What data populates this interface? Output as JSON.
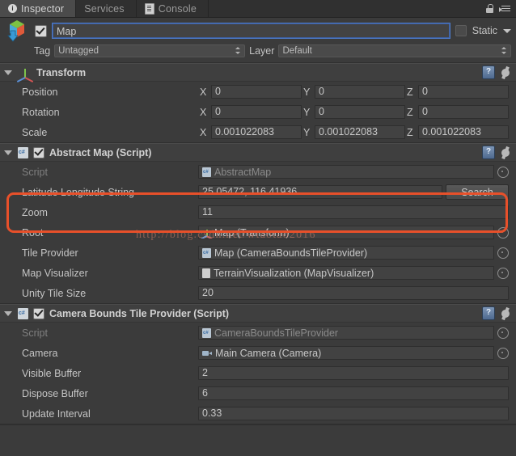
{
  "window": {
    "tabs": [
      {
        "label": "Inspector",
        "icon": "inspector-icon",
        "active": true
      },
      {
        "label": "Services",
        "icon": "",
        "active": false
      },
      {
        "label": "Console",
        "icon": "console-icon",
        "active": false
      }
    ],
    "lock_icon": "lock-icon",
    "menu_icon": "hamburger-menu-icon"
  },
  "gameobject": {
    "icon": "prefab-cube-icon",
    "enabled": true,
    "name": "Map",
    "name_placeholder": "Name",
    "static_label": "Static",
    "static_checked": false,
    "tag_label": "Tag",
    "tag_value": "Untagged",
    "layer_label": "Layer",
    "layer_value": "Default"
  },
  "components": [
    {
      "id": "transform",
      "title": "Transform",
      "icon": "transform-axis-icon",
      "has_checkbox": false,
      "expanded": true,
      "rows": [
        {
          "type": "vector3",
          "label": "Position",
          "axes": [
            "X",
            "Y",
            "Z"
          ],
          "values": [
            "0",
            "0",
            "0"
          ]
        },
        {
          "type": "vector3",
          "label": "Rotation",
          "axes": [
            "X",
            "Y",
            "Z"
          ],
          "values": [
            "0",
            "0",
            "0"
          ]
        },
        {
          "type": "vector3",
          "label": "Scale",
          "axes": [
            "X",
            "Y",
            "Z"
          ],
          "values": [
            "0.001022083",
            "0.001022083",
            "0.001022083"
          ]
        }
      ]
    },
    {
      "id": "abstract-map",
      "title": "Abstract Map (Script)",
      "icon": "csharp-script-icon",
      "has_checkbox": true,
      "checked": true,
      "expanded": true,
      "rows": [
        {
          "type": "object",
          "label": "Script",
          "value": "AbstractMap",
          "dim": true,
          "icon": "csharp-script-icon",
          "picker": true
        },
        {
          "type": "text-button",
          "label": "Latitude Longitude String",
          "value": "25.05472, 116.41936",
          "button": "Search"
        },
        {
          "type": "text",
          "label": "Zoom",
          "value": "11"
        },
        {
          "type": "object",
          "label": "Root",
          "value": "Map (Transform)",
          "icon": "transform-axis-icon",
          "picker": true
        },
        {
          "type": "object",
          "label": "Tile Provider",
          "value": "Map (CameraBoundsTileProvider)",
          "icon": "csharp-script-icon",
          "picker": true
        },
        {
          "type": "object",
          "label": "Map Visualizer",
          "value": "TerrainVisualization (MapVisualizer)",
          "icon": "scriptable-object-icon",
          "picker": true
        },
        {
          "type": "text",
          "label": "Unity Tile Size",
          "value": "20"
        }
      ]
    },
    {
      "id": "camera-bounds-tile-provider",
      "title": "Camera Bounds Tile Provider (Script)",
      "icon": "csharp-script-icon",
      "has_checkbox": true,
      "checked": true,
      "expanded": true,
      "rows": [
        {
          "type": "object",
          "label": "Script",
          "value": "CameraBoundsTileProvider",
          "dim": true,
          "icon": "csharp-script-icon",
          "picker": true
        },
        {
          "type": "object",
          "label": "Camera",
          "value": "Main Camera (Camera)",
          "icon": "camera-icon",
          "picker": true
        },
        {
          "type": "text",
          "label": "Visible Buffer",
          "value": "2"
        },
        {
          "type": "text",
          "label": "Dispose Buffer",
          "value": "6"
        },
        {
          "type": "text",
          "label": "Update Interval",
          "value": "0.33"
        }
      ]
    }
  ],
  "annotation": {
    "highlight_color": "#e8502a",
    "watermark": "http://blog.csdn.net/wtaotao2016"
  }
}
